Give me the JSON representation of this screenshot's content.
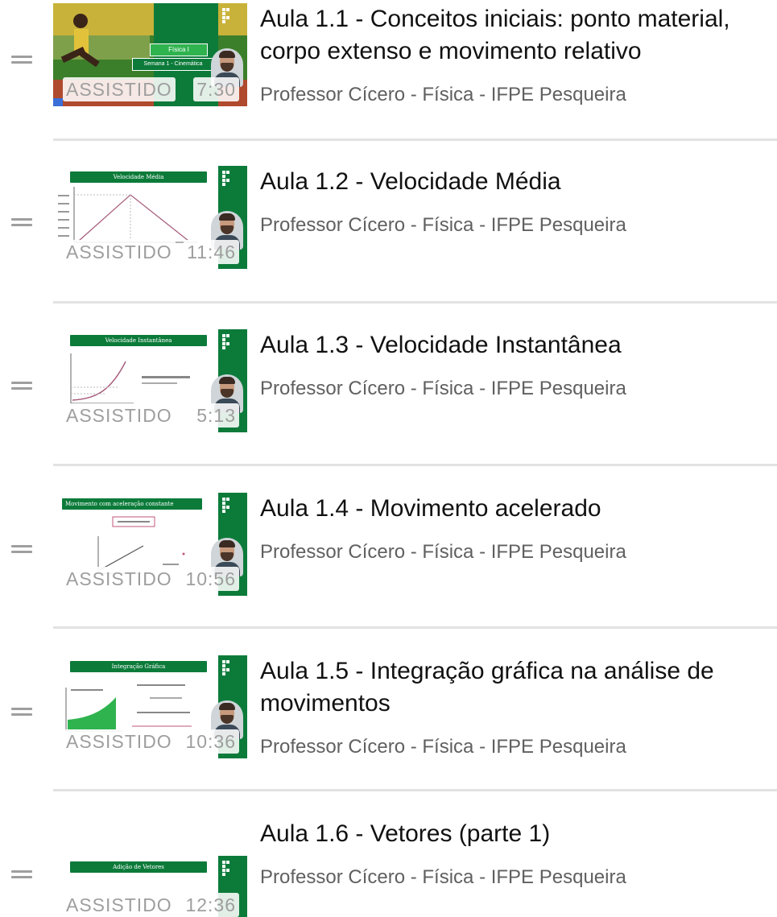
{
  "playlist": {
    "items": [
      {
        "title": "Aula 1.1 - Conceitos iniciais: ponto material, corpo extenso e movimento relativo",
        "channel": "Professor Cícero - Física - IFPE Pesqueira",
        "watched_label": "ASSISTIDO",
        "duration": "7:30",
        "thumb_caption": "Física I",
        "thumb_subcaption": "Semana 1 - Cinemática"
      },
      {
        "title": "Aula 1.2 - Velocidade Média",
        "channel": "Professor Cícero - Física - IFPE Pesqueira",
        "watched_label": "ASSISTIDO",
        "duration": "11:46",
        "thumb_caption": "Velocidade Média"
      },
      {
        "title": "Aula 1.3 - Velocidade Instantânea",
        "channel": "Professor Cícero - Física - IFPE Pesqueira",
        "watched_label": "ASSISTIDO",
        "duration": "5:13",
        "thumb_caption": "Velocidade Instantânea"
      },
      {
        "title": "Aula 1.4 - Movimento acelerado",
        "channel": "Professor Cícero - Física - IFPE Pesqueira",
        "watched_label": "ASSISTIDO",
        "duration": "10:56",
        "thumb_caption": "Movimento com aceleração constante"
      },
      {
        "title": "Aula 1.5 - Integração gráfica na análise de movimentos",
        "channel": "Professor Cícero - Física - IFPE Pesqueira",
        "watched_label": "ASSISTIDO",
        "duration": "10:36",
        "thumb_caption": "Integração Gráfica"
      },
      {
        "title": "Aula 1.6 - Vetores (parte 1)",
        "channel": "Professor Cícero - Física - IFPE Pesqueira",
        "watched_label": "ASSISTIDO",
        "duration": "12:36",
        "thumb_caption": "Adição de Vetores"
      }
    ]
  },
  "colors": {
    "ifpe_green": "#0c7b3a",
    "badge_text": "#9e9e9e",
    "title_text": "#111111",
    "channel_text": "#606060",
    "divider": "#e2e2e2"
  },
  "icons": {
    "drag_handle": "drag-handle-icon",
    "ifpe_logo": "ifpe-logo-icon"
  }
}
